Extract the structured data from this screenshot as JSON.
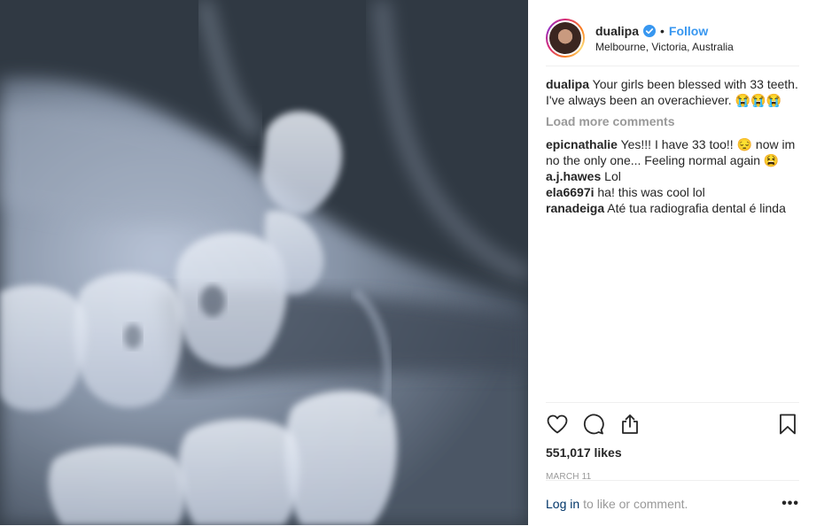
{
  "post": {
    "author": "dualipa",
    "follow_label": "Follow",
    "separator": "•",
    "location": "Melbourne, Victoria, Australia",
    "caption": "Your girls been blessed with 33 teeth. I've always been an overachiever. 😭😭😭",
    "load_more": "Load more comments",
    "comments": [
      {
        "user": "epicnathalie",
        "text": "Yes!!! I have 33 too!! 😔 now im no the only one... Feeling normal again 😫"
      },
      {
        "user": "a.j.hawes",
        "text": "Lol"
      },
      {
        "user": "ela6697i",
        "text": "ha! this was cool lol"
      },
      {
        "user": "ranadeiga",
        "text": "Até tua radiografia dental é linda"
      }
    ],
    "likes": "551,017 likes",
    "date": "MARCH 11",
    "login_link": "Log in",
    "login_rest": "to like or comment.",
    "more_options": "•••"
  },
  "icons": {
    "like": "heart-icon",
    "comment": "comment-icon",
    "share": "share-icon",
    "save": "bookmark-icon",
    "verified": "verified-badge-icon"
  },
  "colors": {
    "link_blue": "#3897f0",
    "login_blue": "#003569",
    "muted": "#999999",
    "text": "#262626"
  }
}
